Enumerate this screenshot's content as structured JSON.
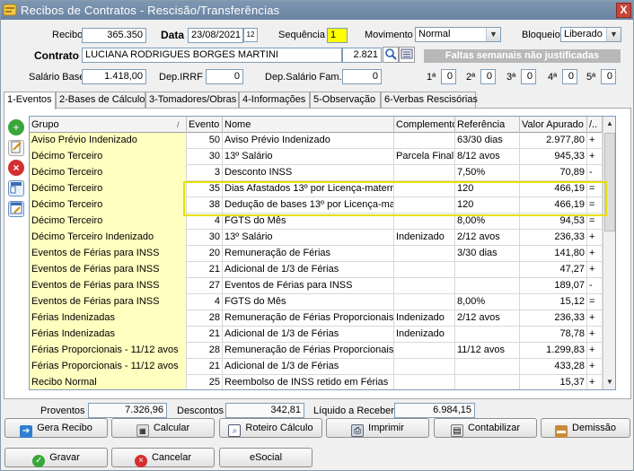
{
  "window": {
    "title": "Recibos de Contratos - Rescisão/Transferências",
    "close": "X"
  },
  "header": {
    "recibo_label": "Recibo",
    "recibo_value": "365.350",
    "data_label": "Data",
    "data_value": "23/08/2021",
    "sequencia_label": "Sequência",
    "sequencia_value": "1",
    "movimento_label": "Movimento",
    "movimento_value": "Normal",
    "bloqueio_label": "Bloqueio",
    "bloqueio_value": "Liberado",
    "contrato_label": "Contrato",
    "contrato_name": "LUCIANA RODRIGUES BORGES MARTINI",
    "contrato_code": "2.821",
    "faltas_banner": "Faltas semanais não justificadas",
    "salario_base_label": "Salário Base",
    "salario_base_value": "1.418,00",
    "dep_irrf_label": "Dep.IRRF",
    "dep_irrf_value": "0",
    "dep_sal_fam_label": "Dep.Salário Fam.",
    "dep_sal_fam_value": "0",
    "weeks": [
      {
        "label": "1ª",
        "value": "0"
      },
      {
        "label": "2ª",
        "value": "0"
      },
      {
        "label": "3ª",
        "value": "0"
      },
      {
        "label": "4ª",
        "value": "0"
      },
      {
        "label": "5ª",
        "value": "0"
      }
    ]
  },
  "tabs": [
    {
      "label": "1-Eventos"
    },
    {
      "label": "2-Bases de Cálculo"
    },
    {
      "label": "3-Tomadores/Obras"
    },
    {
      "label": "4-Informações"
    },
    {
      "label": "5-Observação"
    },
    {
      "label": "6-Verbas Rescisórias"
    }
  ],
  "grid": {
    "columns": [
      "Grupo",
      "Evento",
      "Nome",
      "Complemento",
      "Referência",
      "Valor Apurado",
      "/.."
    ],
    "rows": [
      {
        "grupo": "Aviso Prévio Indenizado",
        "evento": "50",
        "nome": "Aviso Prévio Indenizado",
        "comp": "",
        "ref": "63/30 dias",
        "valor": "2.977,80",
        "s": "+"
      },
      {
        "grupo": "Décimo Terceiro",
        "evento": "30",
        "nome": "13º Salário",
        "comp": "Parcela Final",
        "ref": "8/12 avos",
        "valor": "945,33",
        "s": "+"
      },
      {
        "grupo": "Décimo Terceiro",
        "evento": "3",
        "nome": "Desconto INSS",
        "comp": "",
        "ref": "7,50%",
        "valor": "70,89",
        "s": "-"
      },
      {
        "grupo": "Décimo Terceiro",
        "evento": "35",
        "nome": "Dias Afastados 13º por Licença-materni",
        "comp": "",
        "ref": "120",
        "valor": "466,19",
        "s": "="
      },
      {
        "grupo": "Décimo Terceiro",
        "evento": "38",
        "nome": "Dedução de bases 13º por Licença-mate",
        "comp": "",
        "ref": "120",
        "valor": "466,19",
        "s": "="
      },
      {
        "grupo": "Décimo Terceiro",
        "evento": "4",
        "nome": "FGTS do Mês",
        "comp": "",
        "ref": "8,00%",
        "valor": "94,53",
        "s": "="
      },
      {
        "grupo": "Décimo Terceiro Indenizado",
        "evento": "30",
        "nome": "13º Salário",
        "comp": "Indenizado",
        "ref": "2/12 avos",
        "valor": "236,33",
        "s": "+"
      },
      {
        "grupo": "Eventos de Férias para INSS",
        "evento": "20",
        "nome": "Remuneração de Férias",
        "comp": "",
        "ref": "3/30 dias",
        "valor": "141,80",
        "s": "+"
      },
      {
        "grupo": "Eventos de Férias para INSS",
        "evento": "21",
        "nome": "Adicional de 1/3 de Férias",
        "comp": "",
        "ref": "",
        "valor": "47,27",
        "s": "+"
      },
      {
        "grupo": "Eventos de Férias para INSS",
        "evento": "27",
        "nome": "Eventos de Férias para INSS",
        "comp": "",
        "ref": "",
        "valor": "189,07",
        "s": "-"
      },
      {
        "grupo": "Eventos de Férias para INSS",
        "evento": "4",
        "nome": "FGTS do Mês",
        "comp": "",
        "ref": "8,00%",
        "valor": "15,12",
        "s": "="
      },
      {
        "grupo": "Férias Indenizadas",
        "evento": "28",
        "nome": "Remuneração de Férias Proporcionais",
        "comp": "Indenizado",
        "ref": "2/12 avos",
        "valor": "236,33",
        "s": "+"
      },
      {
        "grupo": "Férias Indenizadas",
        "evento": "21",
        "nome": "Adicional de 1/3 de Férias",
        "comp": "Indenizado",
        "ref": "",
        "valor": "78,78",
        "s": "+"
      },
      {
        "grupo": "Férias Proporcionais - 11/12 avos",
        "evento": "28",
        "nome": "Remuneração de Férias Proporcionais",
        "comp": "",
        "ref": "11/12 avos",
        "valor": "1.299,83",
        "s": "+"
      },
      {
        "grupo": "Férias Proporcionais - 11/12 avos",
        "evento": "21",
        "nome": "Adicional de 1/3 de Férias",
        "comp": "",
        "ref": "",
        "valor": "433,28",
        "s": "+"
      },
      {
        "grupo": "Recibo Normal",
        "evento": "25",
        "nome": "Reembolso de INSS retido em Férias",
        "comp": "",
        "ref": "",
        "valor": "15,37",
        "s": "+"
      }
    ]
  },
  "totals": {
    "proventos_label": "Proventos",
    "proventos_value": "7.326,96",
    "descontos_label": "Descontos",
    "descontos_value": "342,81",
    "liquido_label": "Líquido a Receber",
    "liquido_value": "6.984,15"
  },
  "buttons": {
    "gera_recibo": "Gera Recibo",
    "calcular": "Calcular",
    "roteiro": "Roteiro Cálculo",
    "imprimir": "Imprimir",
    "contabilizar": "Contabilizar",
    "demissao": "Demissão",
    "gravar": "Gravar",
    "cancelar": "Cancelar",
    "esocial": "eSocial"
  },
  "colors": {
    "title_bar": "#7e97b2",
    "group_cell": "#ffffc0",
    "highlight": "#e8e000",
    "sequence_field": "#ffff00",
    "banner": "#b8b8b8"
  }
}
